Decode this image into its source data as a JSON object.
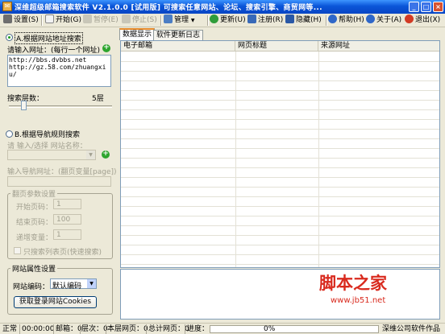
{
  "window": {
    "title": "深维超级邮箱搜索软件 V2.1.0.0 [试用版] 可搜索任意网站、论坛、搜索引擎、商贸网等...",
    "min": "_",
    "max": "□",
    "close": "×"
  },
  "toolbar": {
    "settings": "设置(S)",
    "start": "开始(G)",
    "pause": "暂停(E)",
    "stop": "停止(S)",
    "manage": "管理",
    "update": "更新(U)",
    "register": "注册(R)",
    "hide": "隐藏(H)",
    "help": "帮助(H)",
    "about": "关于(A)",
    "exit": "退出(X)",
    "dropdown": "▼"
  },
  "left": {
    "section_a_label": "A.根据网站地址搜索",
    "url_input_label": "请输入网址：(每行一个网址)",
    "urls": "http://bbs.dvbbs.net\nhttp://gz.58.com/zhuangxiu/",
    "search_depth_label": "搜索层数：",
    "search_depth_value": "5层",
    "search_depth_level": 0.12,
    "section_b_label": "B.根据导航规则搜索",
    "site_select_label": "请 输入/选择 网站名称：",
    "nav_url_label": "输入导航网址：(翻页变量[page])",
    "paging": {
      "title": "翻页参数设置",
      "start_label": "开始页码：",
      "start_value": "1",
      "end_label": "结束页码：",
      "end_value": "100",
      "inc_label": "递增变量：",
      "inc_value": "1",
      "only_list_label": "只搜索列表页(快速搜索)"
    },
    "site_attr": {
      "title": "网站属性设置",
      "encoding_label": "网站编码：",
      "encoding_value": "默认编码",
      "cookies_button": "获取登录网站Cookies"
    }
  },
  "tabs": [
    "数据显示",
    "软件更新日志"
  ],
  "grid": {
    "columns": [
      "电子邮箱",
      "网页标题",
      "来源网址"
    ]
  },
  "watermark": {
    "logo_text": "脚本之家",
    "url": "www.jb51.net"
  },
  "status": {
    "state": "正常",
    "time": "00:00:00",
    "mail": "邮箱：0",
    "level": "层次：0",
    "page": "本层网页：0",
    "total": "总计网页：0",
    "progress_label": "进度：",
    "progress_value": "0%",
    "progress_fraction": 0,
    "company": "深维公司软件作品"
  },
  "colors": {
    "titlebar": "#0a55d8",
    "face": "#ece9d8",
    "accent_orange": "#e68b2c",
    "green": "#2ea52e",
    "watermark_red": "#d92a1e"
  }
}
